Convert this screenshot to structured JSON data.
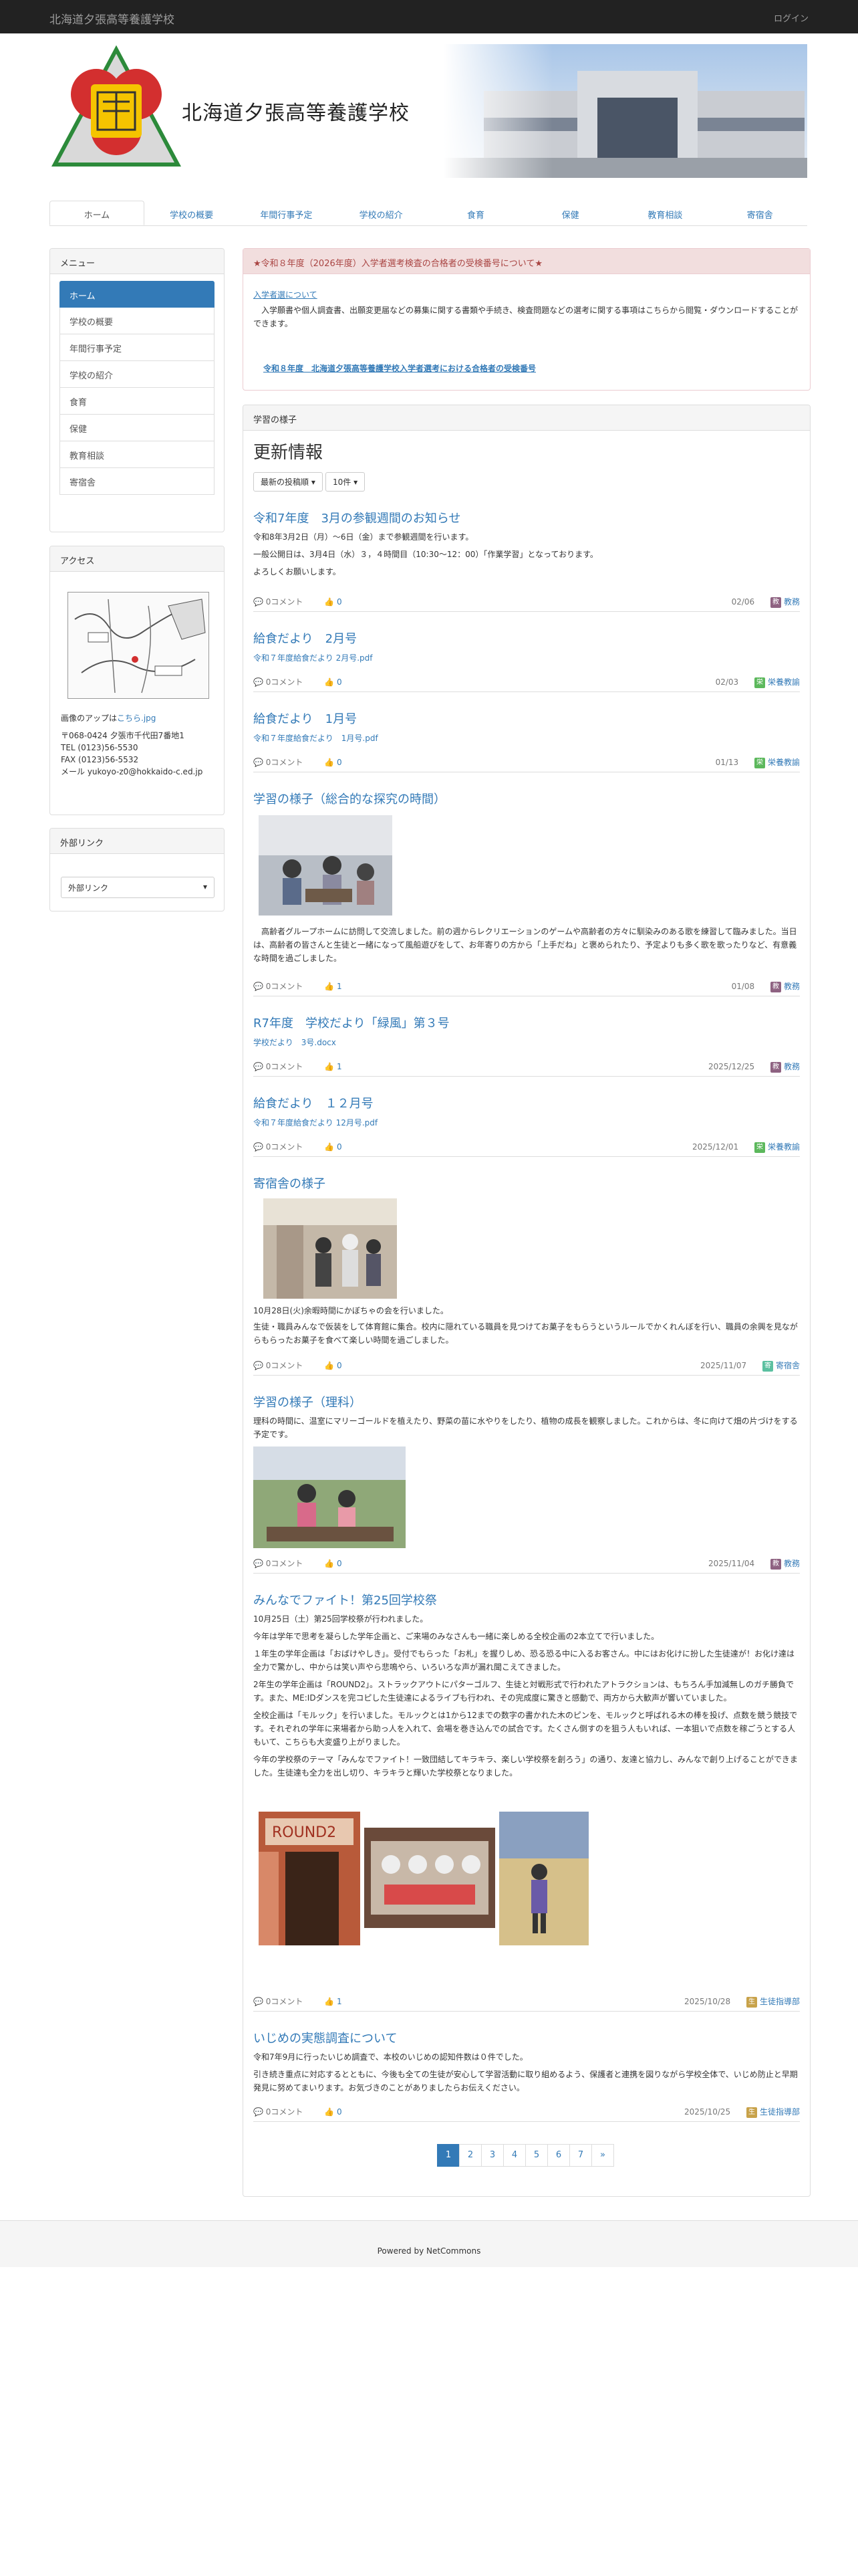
{
  "navbar": {
    "site_name": "北海道夕張高等養護学校",
    "login": "ログイン"
  },
  "header": {
    "school_name": "北海道夕張高等養護学校"
  },
  "tabs": [
    "ホーム",
    "学校の概要",
    "年間行事予定",
    "学校の紹介",
    "食育",
    "保健",
    "教育相談",
    "寄宿舎"
  ],
  "sidebar": {
    "menu_title": "メニュー",
    "menu_items": [
      "ホーム",
      "学校の概要",
      "年間行事予定",
      "学校の紹介",
      "食育",
      "保健",
      "教育相談",
      "寄宿舎"
    ],
    "access_title": "アクセス",
    "map_note_prefix": "画像のアップは",
    "map_note_link": "こちら.jpg",
    "address": [
      "〒068-0424 夕張市千代田7番地1",
      "TEL (0123)56-5530",
      "FAX (0123)56-5532",
      "メール yukoyo-z0@hokkaido-c.ed.jp"
    ],
    "links_title": "外部リンク",
    "links_select": "外部リンク"
  },
  "notice": {
    "title": "★令和８年度（2026年度）入学者選考検査の合格者の受検番号について★",
    "link1": "入学者選について",
    "text": "入学願書や個人調査書、出願変更届などの募集に関する書類や手続き、検査問題などの選考に関する事項はこちらから閲覧・ダウンロードすることができます。",
    "link2": "令和８年度　北海道夕張高等養護学校入学者選考における合格者の受検番号"
  },
  "main": {
    "panel_title": "学習の様子",
    "heading": "更新情報",
    "sort_button": "最新の投稿順",
    "count_button": "10件",
    "entries": [
      {
        "title": "令和7年度　3月の参観週間のお知らせ",
        "lines": [
          "令和8年3月2日（月）〜6日（金）まで参観週間を行います。",
          "一般公開日は、3月4日（水）３，４時間目（10:30〜12：00）「作業学習」となっております。",
          "よろしくお願いします。"
        ],
        "comments": "0コメント",
        "likes": "0",
        "date": "02/06",
        "category": "教務",
        "cat_color": "#8e6281",
        "cat_icon": "教"
      },
      {
        "title": "給食だより　2月号",
        "file": "令和７年度給食だより 2月号.pdf",
        "comments": "0コメント",
        "likes": "0",
        "date": "02/03",
        "category": "栄養教諭",
        "cat_color": "#5cb85c",
        "cat_icon": "栄"
      },
      {
        "title": "給食だより　1月号",
        "file": "令和７年度給食だより　1月号.pdf",
        "comments": "0コメント",
        "likes": "0",
        "date": "01/13",
        "category": "栄養教諭",
        "cat_color": "#5cb85c",
        "cat_icon": "栄"
      },
      {
        "title": "学習の様子（総合的な探究の時間）",
        "text": "高齢者グループホームに訪問して交流しました。前の週からレクリエーションのゲームや高齢者の方々に馴染みのある歌を練習して臨みました。当日は、高齢者の皆さんと生徒と一緒になって風船遊びをして、お年寄りの方から「上手だね」と褒められたり、予定よりも多く歌を歌ったりなど、有意義な時間を過ごしました。",
        "comments": "0コメント",
        "likes": "1",
        "date": "01/08",
        "category": "教務",
        "cat_color": "#8e6281",
        "cat_icon": "教"
      },
      {
        "title": "R7年度　学校だより「緑風」第３号",
        "file": "学校だより　3号.docx",
        "comments": "0コメント",
        "likes": "1",
        "date": "2025/12/25",
        "category": "教務",
        "cat_color": "#8e6281",
        "cat_icon": "教"
      },
      {
        "title": "給食だより　１２月号",
        "file": "令和７年度給食だより 12月号.pdf",
        "comments": "0コメント",
        "likes": "0",
        "date": "2025/12/01",
        "category": "栄養教諭",
        "cat_color": "#5cb85c",
        "cat_icon": "栄"
      },
      {
        "title": "寄宿舎の様子",
        "lines": [
          "10月28日(火)余暇時間にかぼちゃの会を行いました。",
          "生徒・職員みんなで仮装をして体育館に集合。校内に隠れている職員を見つけてお菓子をもらうというルールでかくれんぼを行い、職員の余興を見ながらもらったお菓子を食べて楽しい時間を過ごしました。"
        ],
        "comments": "0コメント",
        "likes": "0",
        "date": "2025/11/07",
        "category": "寄宿舎",
        "cat_color": "#5bc0a0",
        "cat_icon": "寄"
      },
      {
        "title": "学習の様子（理科）",
        "text": "理科の時間に、温室にマリーゴールドを植えたり、野菜の苗に水やりをしたり、植物の成長を観察しました。これからは、冬に向けて畑の片づけをする予定です。",
        "comments": "0コメント",
        "likes": "0",
        "date": "2025/11/04",
        "category": "教務",
        "cat_color": "#8e6281",
        "cat_icon": "教"
      },
      {
        "title": "みんなでファイト！第25回学校祭",
        "lines": [
          "10月25日（土）第25回学校祭が行われました。",
          "今年は学年で思考を凝らした学年企画と、ご来場のみなさんも一緒に楽しめる全校企画の2本立てで行いました。",
          "１年生の学年企画は「おばけやしき」。受付でもらった「お札」を握りしめ、恐る恐る中に入るお客さん。中にはお化けに扮した生徒達が！お化け達は全力で驚かし、中からは笑い声やら悲鳴やら、いろいろな声が漏れ聞こえてきました。",
          "2年生の学年企画は「ROUND2」。ストラックアウトにパターゴルフ、生徒と対戦形式で行われたアトラクションは、もちろん手加減無しのガチ勝負です。また、ME:IDダンスを完コピした生徒達によるライブも行われ、その完成度に驚きと感動で、両方から大歓声が響いていました。",
          "全校企画は「モルック」を行いました。モルックとは1から12までの数字の書かれた木のピンを、モルックと呼ばれる木の棒を投げ、点数を競う競技です。それぞれの学年に来場者から助っ人を入れて、会場を巻き込んでの試合です。たくさん倒すのを狙う人もいれば、一本狙いで点数を稼ごうとする人もいて、こちらも大変盛り上がりました。",
          "今年の学校祭のテーマ「みんなでファイト！一致団結してキラキラ、楽しい学校祭を創ろう」の通り、友達と協力し、みんなで創り上げることができました。生徒達も全力を出し切り、キラキラと輝いた学校祭となりました。"
        ],
        "comments": "0コメント",
        "likes": "1",
        "date": "2025/10/28",
        "category": "生徒指導部",
        "cat_color": "#c8a24a",
        "cat_icon": "生"
      },
      {
        "title": "いじめの実態調査について",
        "lines": [
          "令和7年9月に行ったいじめ調査で、本校のいじめの認知件数は０件でした。",
          "引き続き重点に対応するとともに、今後も全ての生徒が安心して学習活動に取り組めるよう、保護者と連携を図りながら学校全体で、いじめ防止と早期発見に努めてまいります。お気づきのことがありましたらお伝えください。"
        ],
        "comments": "0コメント",
        "likes": "0",
        "date": "2025/10/25",
        "category": "生徒指導部",
        "cat_color": "#c8a24a",
        "cat_icon": "生"
      }
    ],
    "pagination": [
      "1",
      "2",
      "3",
      "4",
      "5",
      "6",
      "7",
      "»"
    ]
  },
  "footer": {
    "text": "Powered by NetCommons"
  },
  "colors": {
    "navbar": "#222222",
    "accent": "#337ab7",
    "notice_bg": "#f2dede"
  }
}
